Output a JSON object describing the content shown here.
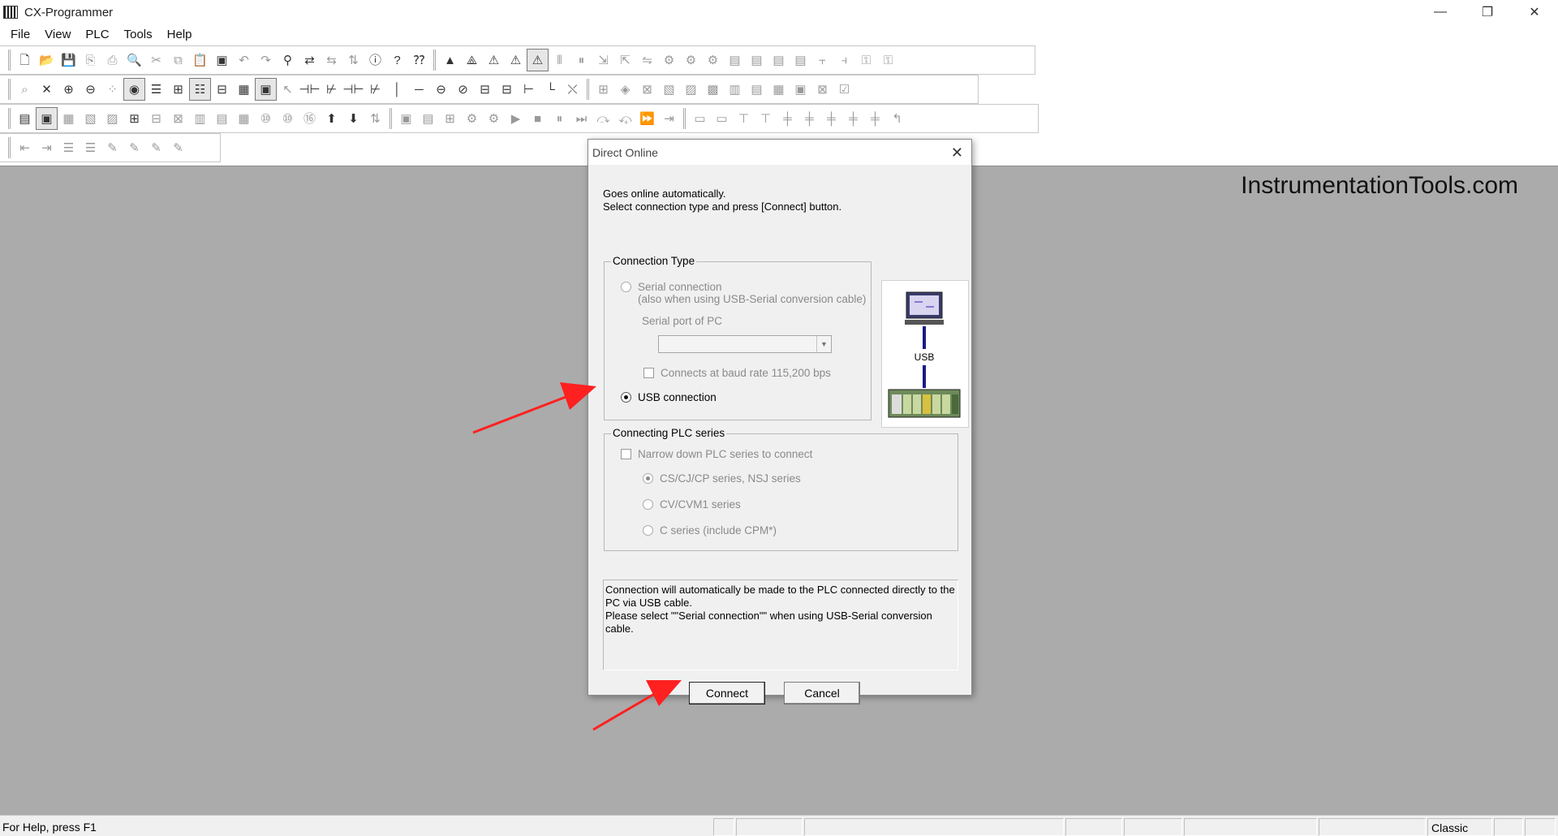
{
  "window": {
    "title": "CX-Programmer",
    "minimize_glyph": "—",
    "restore_glyph": "❐",
    "close_glyph": "✕"
  },
  "menu": {
    "items": [
      "File",
      "View",
      "PLC",
      "Tools",
      "Help"
    ]
  },
  "watermark": "InstrumentationTools.com",
  "dialog": {
    "title": "Direct Online",
    "close_glyph": "✕",
    "intro_line1": "Goes online automatically.",
    "intro_line2": "Select connection type and press [Connect] button.",
    "connection_type": {
      "label": "Connection Type",
      "serial_label": "Serial connection",
      "serial_sub": "(also when using USB-Serial conversion cable)",
      "serial_port_label": "Serial port of PC",
      "serial_port_value": "",
      "baud_label": "Connects at baud rate 115,200 bps",
      "usb_label": "USB connection",
      "selected": "usb"
    },
    "diagram": {
      "usb_label": "USB"
    },
    "plc_series": {
      "label": "Connecting PLC series",
      "narrow_label": "Narrow down PLC series to connect",
      "options": [
        "CS/CJ/CP series, NSJ series",
        "CV/CVM1 series",
        "C series (include CPM*)"
      ],
      "selected_index": 0
    },
    "info_text": "Connection will automatically be made to the PLC connected directly to the PC via USB cable.\nPlease select \"\"Serial connection\"\" when using USB-Serial conversion cable.",
    "connect_label": "Connect",
    "cancel_label": "Cancel"
  },
  "status": {
    "help_text": "For Help, press F1",
    "mode_text": "Classic"
  },
  "colors": {
    "workspace": "#ababab",
    "arrow": "#ff2020",
    "usb_line": "#1a1a8a"
  }
}
